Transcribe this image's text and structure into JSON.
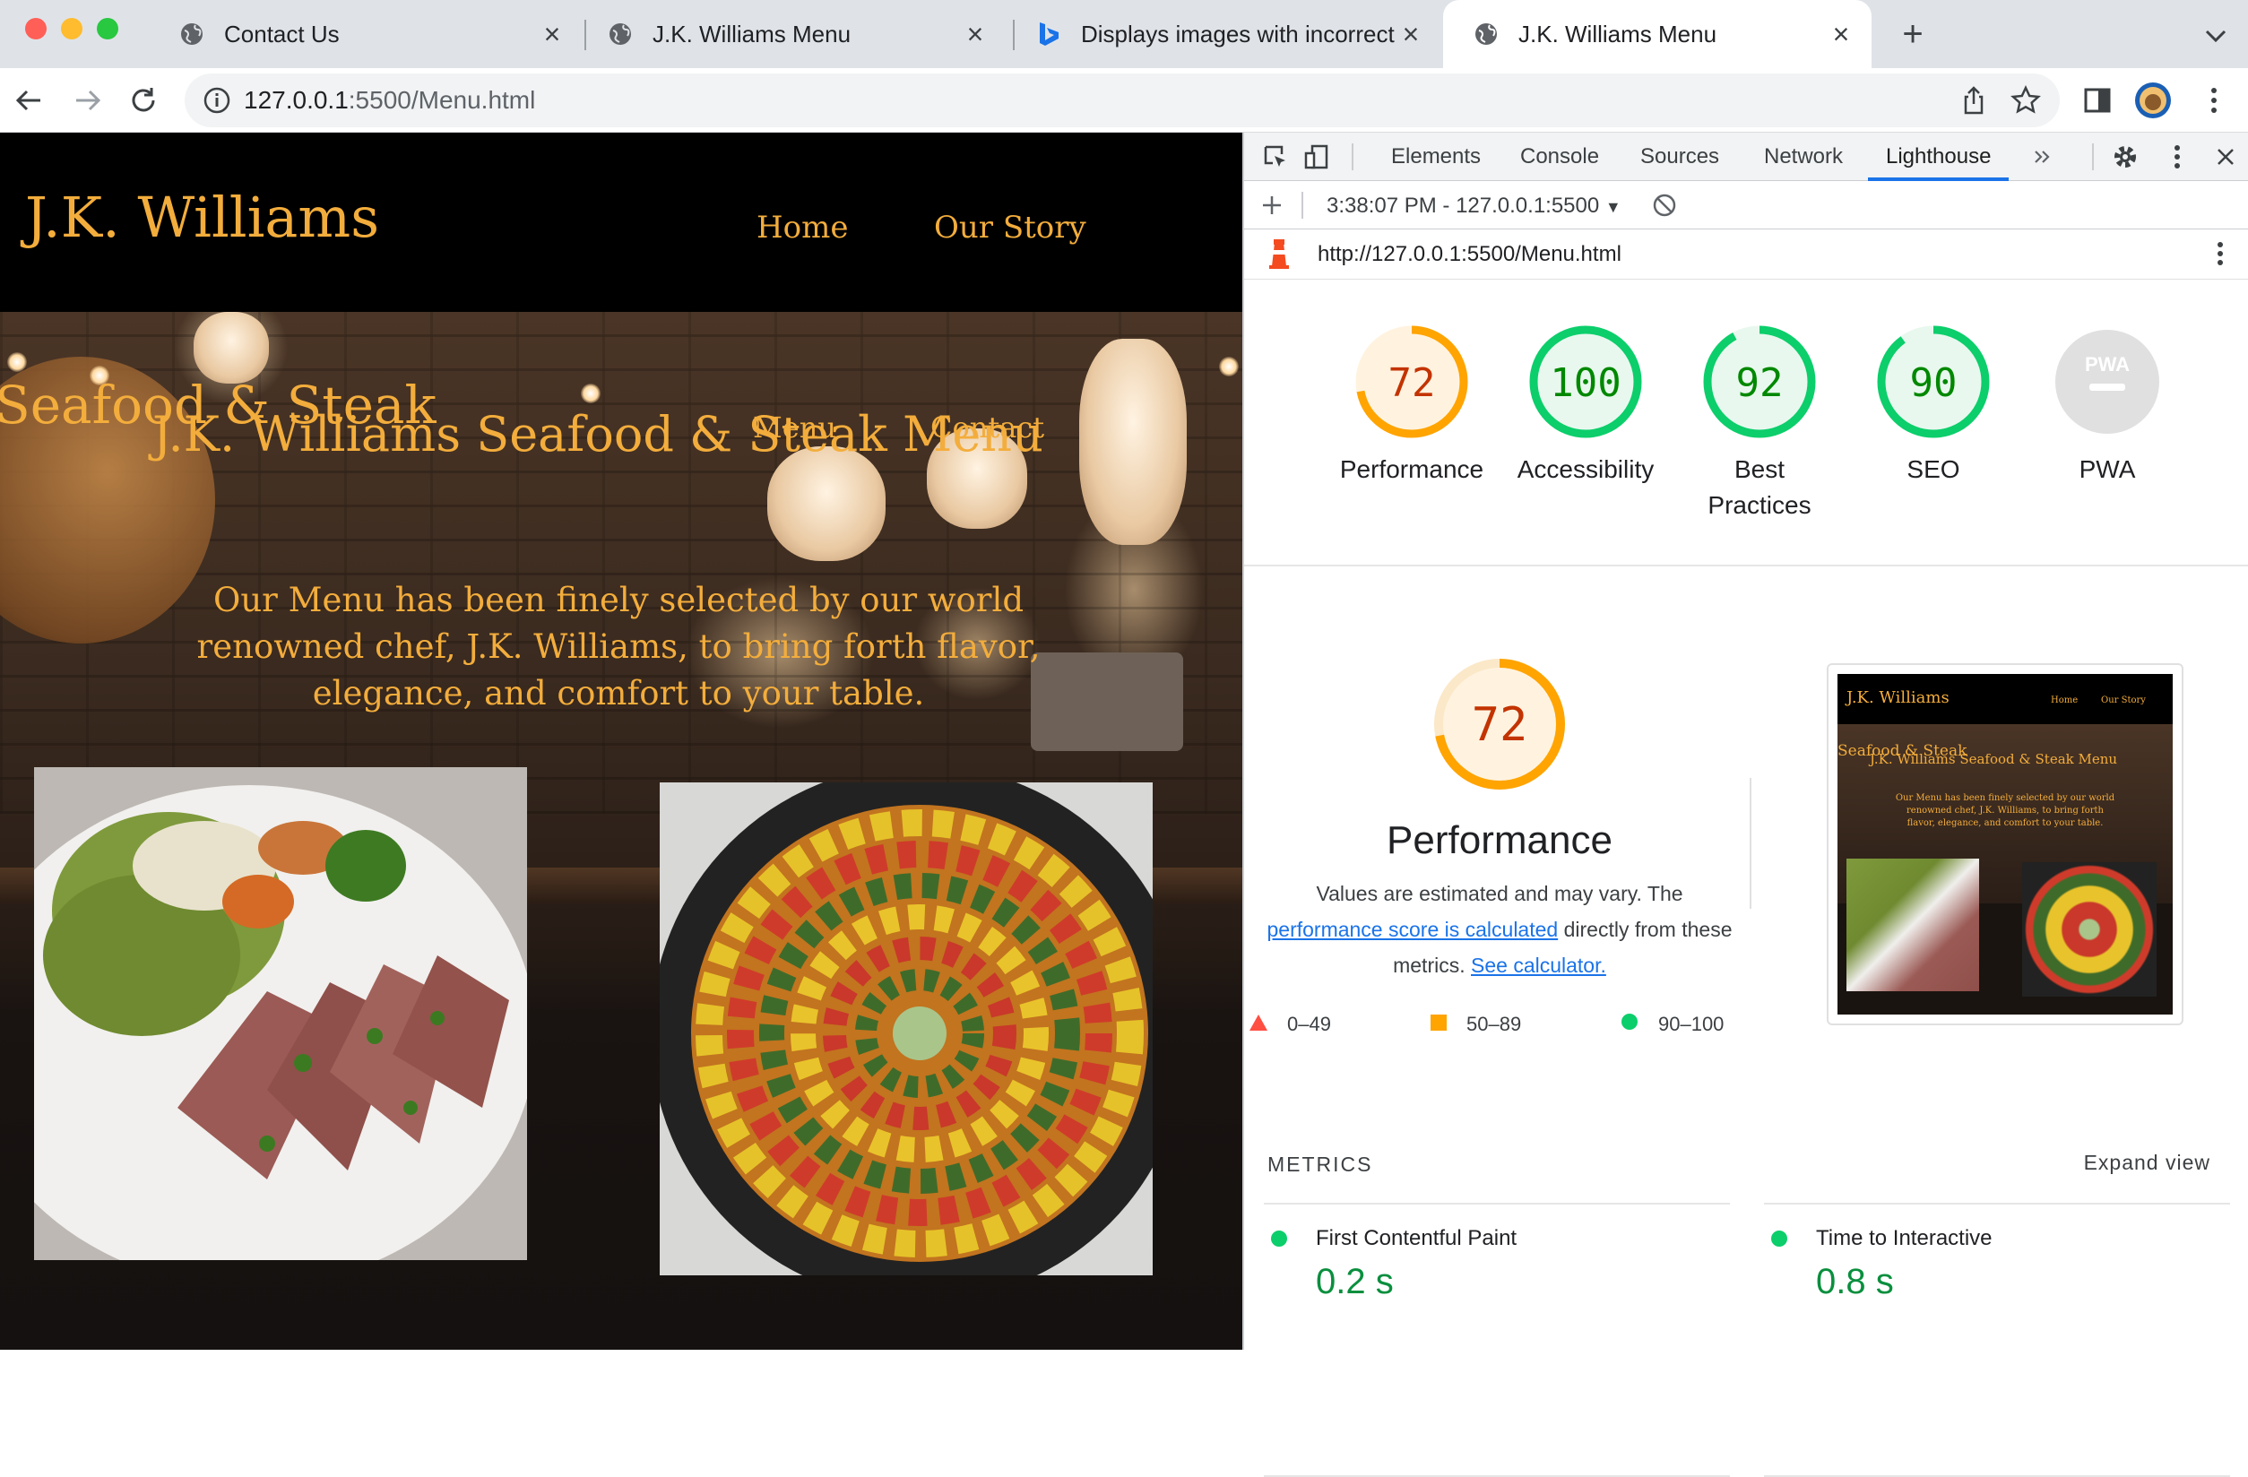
{
  "browser": {
    "tabs": [
      {
        "title": "Contact Us",
        "icon": "globe-icon"
      },
      {
        "title": "J.K. Williams Menu",
        "icon": "globe-icon"
      },
      {
        "title": "Displays images with incorrect",
        "icon": "bing-icon"
      },
      {
        "title": "J.K. Williams Menu",
        "icon": "globe-icon"
      }
    ],
    "url_host": "127.0.0.1",
    "url_path": ":5500/Menu.html"
  },
  "site": {
    "logo": "J.K. Williams",
    "nav": [
      "Home",
      "Our Story"
    ],
    "overlap_title_left": "Seafood & Steak",
    "page_title": "J.K. Williams Seafood & Steak Menu",
    "overlap_nav": [
      "Menu",
      "Contact"
    ],
    "intro": "Our Menu has been finely selected by our world renowned chef, J.K. Williams, to bring forth flavor, elegance, and comfort to your table."
  },
  "devtools": {
    "tabs": [
      "Elements",
      "Console",
      "Sources",
      "Network",
      "Lighthouse"
    ],
    "active_tab": "Lighthouse",
    "report_select": "3:38:07 PM - 127.0.0.1:5500",
    "report_url": "http://127.0.0.1:5500/Menu.html",
    "scores": [
      {
        "label": "Performance",
        "score": "72",
        "value": 72,
        "color": "#ffa400",
        "text_color": "#c33300",
        "fill": "#fff3e0"
      },
      {
        "label": "Accessibility",
        "score": "100",
        "value": 100,
        "color": "#0cce6b",
        "text_color": "#008800",
        "fill": "#e8f8ee"
      },
      {
        "label": "Best Practices",
        "score": "92",
        "value": 92,
        "color": "#0cce6b",
        "text_color": "#008800",
        "fill": "#e8f8ee"
      },
      {
        "label": "SEO",
        "score": "90",
        "value": 90,
        "color": "#0cce6b",
        "text_color": "#008800",
        "fill": "#e8f8ee"
      },
      {
        "label": "PWA",
        "score": "PWA",
        "value": null,
        "color": "#cccccc",
        "text_color": "#ffffff",
        "fill": "#e0e0e0"
      }
    ],
    "perf": {
      "score": "72",
      "title": "Performance",
      "desc_1": "Values are estimated and may vary. The",
      "link_1": "performance score is calculated",
      "desc_2": "directly from these metrics.",
      "link_2": "See calculator."
    },
    "legend": [
      "0–49",
      "50–89",
      "90–100"
    ],
    "thumb": {
      "logo": "J.K. Williams",
      "nav": [
        "Home",
        "Our Story"
      ],
      "title_left": "Seafood & Steak",
      "title": "J.K. Williams Seafood & Steak Menu",
      "intro": "Our Menu has been finely selected by our world renowned chef, J.K. Williams, to bring forth flavor, elegance, and comfort to your table."
    },
    "metrics_heading": "METRICS",
    "expand_view": "Expand view",
    "metrics": [
      {
        "name": "First Contentful Paint",
        "value": "0.2 s"
      },
      {
        "name": "Time to Interactive",
        "value": "0.8 s"
      }
    ]
  },
  "colors": {
    "gold": "#f3ad3c",
    "accent": "#1a73e8",
    "pass": "#0cce6b",
    "average": "#ffa400",
    "fail": "#ff4e42"
  }
}
